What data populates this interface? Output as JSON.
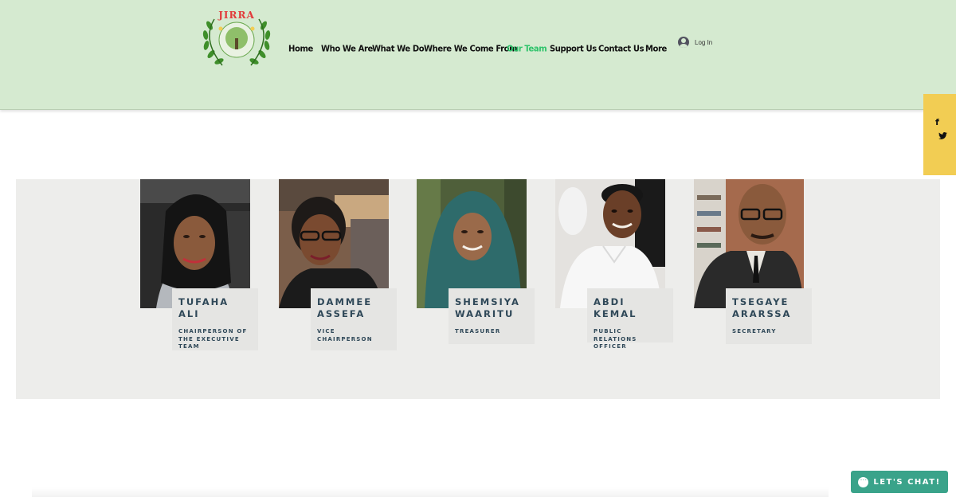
{
  "brand": {
    "logo_text": "JIRRA"
  },
  "nav": {
    "items": [
      {
        "label": "Home"
      },
      {
        "label": "Who We Are"
      },
      {
        "label": "What We Do"
      },
      {
        "label": "Where We Come From"
      },
      {
        "label": "Our Team",
        "active": true
      },
      {
        "label": "Support Us"
      },
      {
        "label": "Contact Us"
      },
      {
        "label": "More"
      }
    ],
    "login_label": "Log In"
  },
  "social": {
    "icons": [
      "facebook-icon",
      "twitter-icon"
    ],
    "facebook_glyph": "f",
    "twitter_glyph": "➔"
  },
  "colors": {
    "header_bg": "#d5ead0",
    "active_nav": "#2ec36a",
    "social_bar": "#f2cd53",
    "team_bg": "#ededeb",
    "card_bg": "#e5e5e3",
    "name_color": "#2f4858",
    "chat_button": "#3aa38a"
  },
  "team": {
    "members": [
      {
        "name": "TUFAHA ALI",
        "role": "CHAIRPERSON OF THE EXECUTIVE TEAM"
      },
      {
        "name": "DAMMEE ASSEFA",
        "role": "VICE CHAIRPERSON"
      },
      {
        "name": "SHEMSIYA WAARITU",
        "role": "TREASURER"
      },
      {
        "name": "ABDI KEMAL",
        "role": "PUBLIC RELATIONS OFFICER"
      },
      {
        "name": "TSEGAYE ARARSSA",
        "role": "SECRETARY"
      }
    ]
  },
  "chat": {
    "label": "LET'S CHAT!"
  }
}
